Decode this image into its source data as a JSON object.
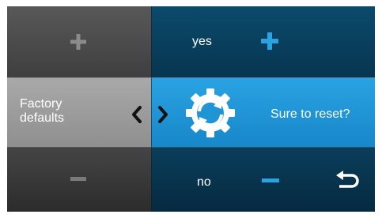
{
  "left_panel": {
    "label_line1": "Factory",
    "label_line2": "defaults"
  },
  "right_panel": {
    "yes_label": "yes",
    "prompt": "Sure to reset?",
    "no_label": "no"
  },
  "icons": {
    "left_plus": "plus-icon",
    "left_minus": "minus-icon",
    "yes_plus": "plus-icon",
    "no_minus": "minus-icon",
    "chevron_left": "chevron-left-icon",
    "chevron_right": "chevron-right-icon",
    "reset": "gear-reset-icon",
    "back": "back-arrow-icon"
  },
  "colors": {
    "accent_blue": "#2aa3e3",
    "dark_blue": "#073550",
    "grey_active": "#a0a0a0",
    "grey_dark": "#3f3f3f"
  }
}
